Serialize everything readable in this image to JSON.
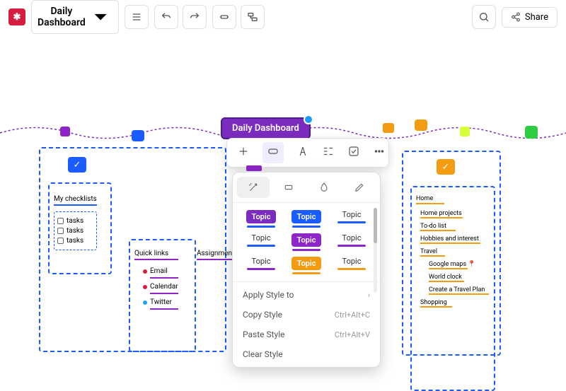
{
  "toolbar": {
    "title": "Daily Dashboard",
    "share": "Share"
  },
  "root": {
    "label": "Daily Dashboard"
  },
  "checklists": {
    "title": "My checklists",
    "items": [
      "tasks",
      "tasks",
      "tasks"
    ]
  },
  "quicklinks": {
    "title": "Quick links",
    "items": [
      "Email",
      "Calendar",
      "Twitter"
    ]
  },
  "assignments": {
    "title": "Assignments"
  },
  "home": {
    "title": "Home",
    "items": [
      "Home projects",
      "To-do list",
      "Hobbies and interest",
      "Travel",
      "Google maps",
      "World clock",
      "Create a Travel  Plan",
      "Shopping"
    ]
  },
  "styles": {
    "swatches": [
      "Topic",
      "Topic",
      "Topic",
      "Topic",
      "Topic",
      "Topic",
      "Topic",
      "Topic",
      "Topic"
    ],
    "menu": [
      {
        "label": "Apply Style to",
        "sc": "›"
      },
      {
        "label": "Copy Style",
        "sc": "Ctrl+Alt+C"
      },
      {
        "label": "Paste Style",
        "sc": "Ctrl+Alt+V"
      },
      {
        "label": "Clear Style",
        "sc": ""
      }
    ]
  }
}
